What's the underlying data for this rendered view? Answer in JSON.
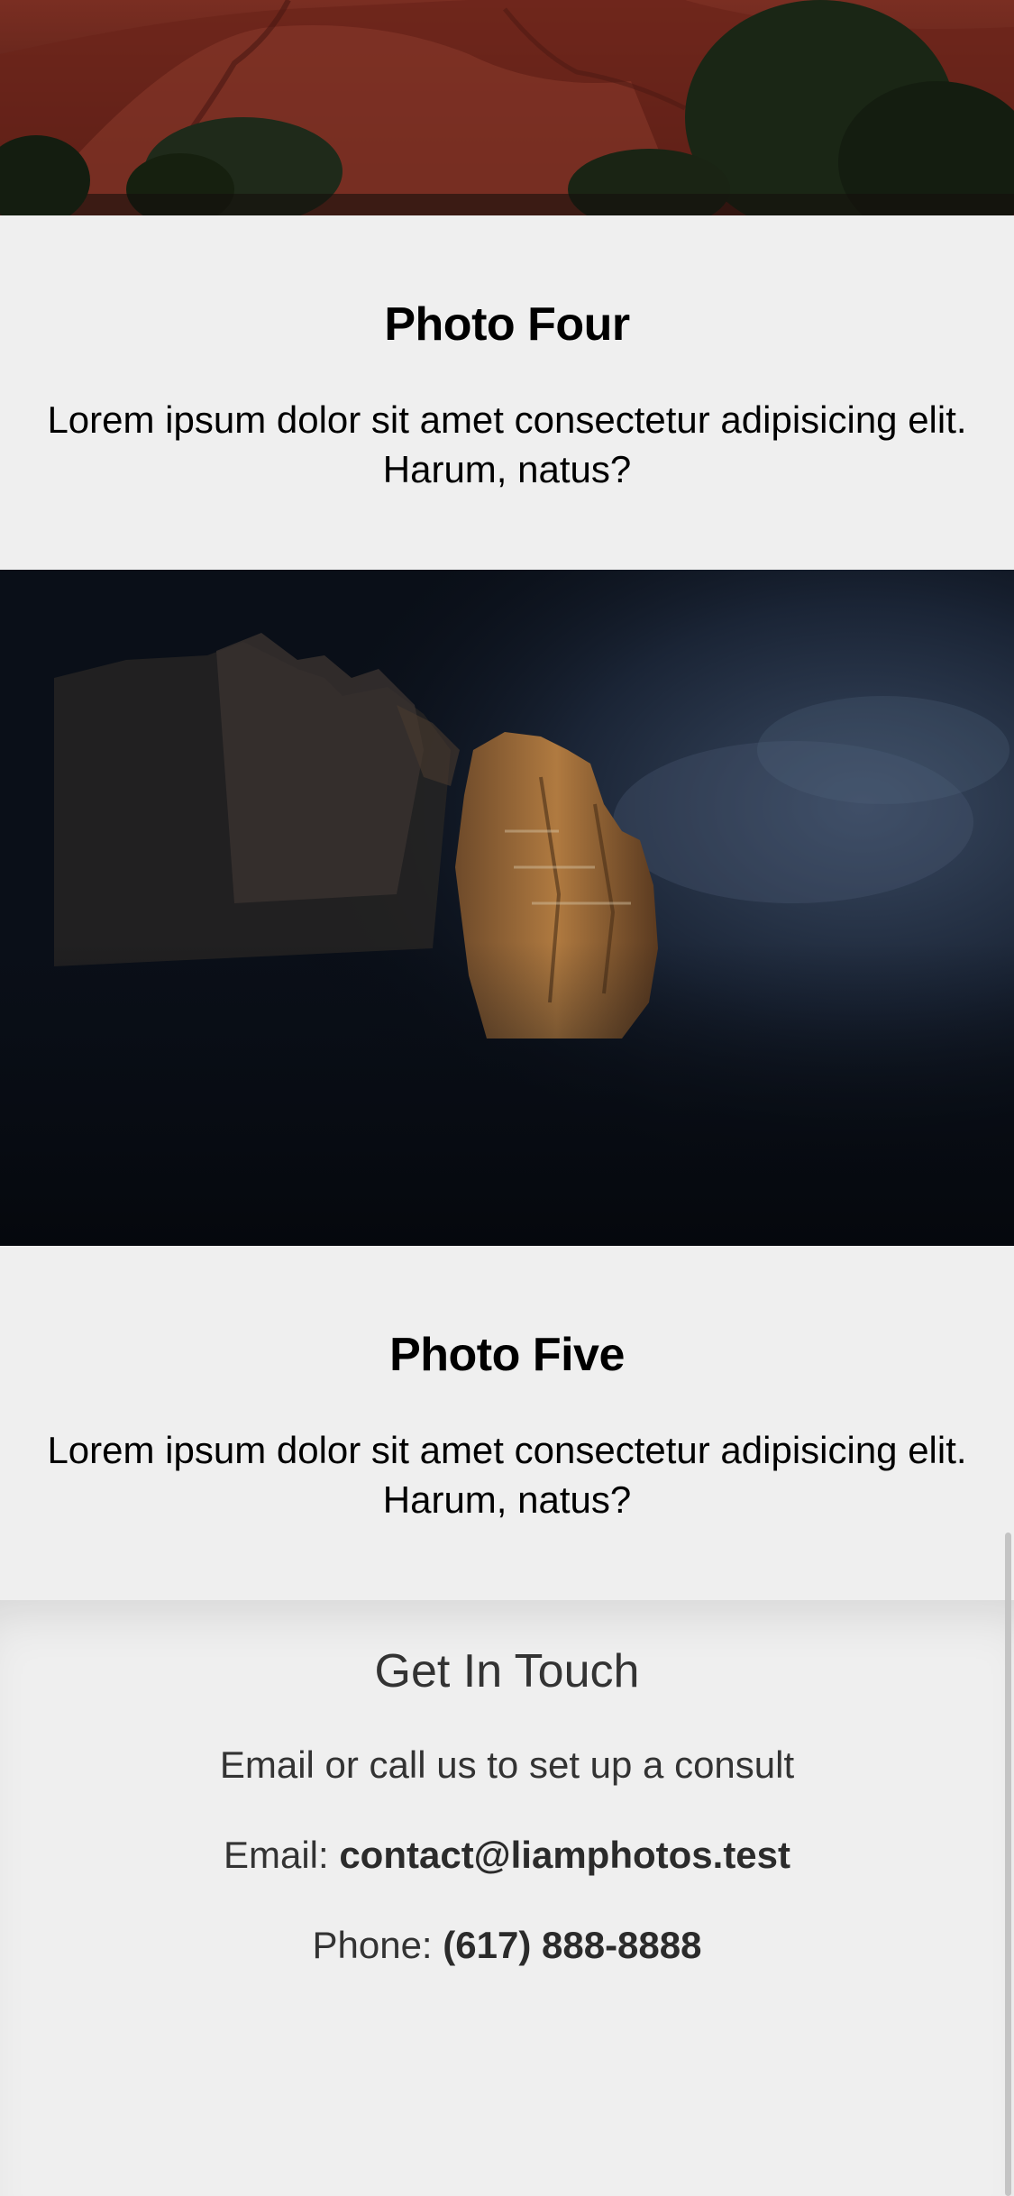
{
  "photos": [
    {
      "title": "Photo Four",
      "description": "Lorem ipsum dolor sit amet consectetur adipisicing elit. Harum, natus?",
      "image_subject": "red rock canyon"
    },
    {
      "title": "Photo Five",
      "description": "Lorem ipsum dolor sit amet consectetur adipisicing elit. Harum, natus?",
      "image_subject": "sunlit mountain peak in dark clouds"
    }
  ],
  "contact": {
    "heading": "Get In Touch",
    "tagline": "Email or call us to set up a consult",
    "email_label": "Email: ",
    "email_value": "contact@liamphotos.test",
    "phone_label": "Phone: ",
    "phone_value": "(617) 888-8888"
  },
  "colors": {
    "background": "#efefef",
    "text": "#000000",
    "contact_text": "#333333"
  }
}
